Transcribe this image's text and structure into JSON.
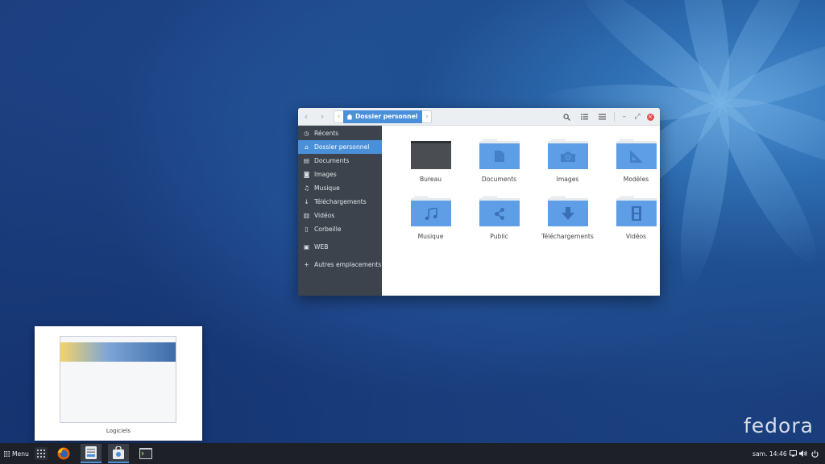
{
  "desktop": {
    "brand": "fedora"
  },
  "file_manager": {
    "location": "Dossier personnel",
    "sidebar": [
      {
        "label": "Récents",
        "icon": "clock-icon"
      },
      {
        "label": "Dossier personnel",
        "icon": "home-icon",
        "active": true
      },
      {
        "label": "Documents",
        "icon": "document-icon"
      },
      {
        "label": "Images",
        "icon": "camera-icon"
      },
      {
        "label": "Musique",
        "icon": "music-icon"
      },
      {
        "label": "Téléchargements",
        "icon": "download-icon"
      },
      {
        "label": "Vidéos",
        "icon": "film-icon"
      },
      {
        "label": "Corbeille",
        "icon": "trash-icon"
      },
      {
        "label": "WEB",
        "icon": "drive-icon"
      },
      {
        "label": "Autres emplacements",
        "icon": "plus-icon"
      }
    ],
    "folders": [
      {
        "label": "Bureau",
        "icon": "desktop-icon"
      },
      {
        "label": "Documents",
        "icon": "document-icon"
      },
      {
        "label": "Images",
        "icon": "camera-icon"
      },
      {
        "label": "Modèles",
        "icon": "template-icon"
      },
      {
        "label": "Musique",
        "icon": "music-icon"
      },
      {
        "label": "Public",
        "icon": "share-icon"
      },
      {
        "label": "Téléchargements",
        "icon": "download-icon"
      },
      {
        "label": "Vidéos",
        "icon": "film-icon"
      }
    ]
  },
  "window_preview": {
    "title": "Logiciels"
  },
  "taskbar": {
    "menu_label": "Menu",
    "clock": "sam. 14:46"
  }
}
